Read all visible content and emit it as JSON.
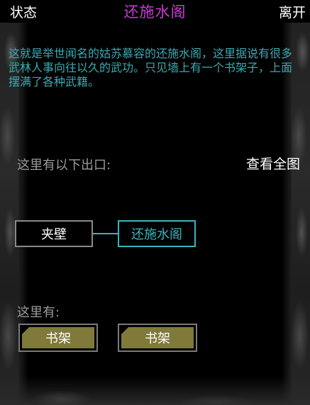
{
  "topbar": {
    "status_label": "状态",
    "room_title": "还施水阁",
    "leave_label": "离开"
  },
  "description": "这就是举世闻名的姑苏慕容的还施水阁，这里据说有很多武林人事向往以久的武功。只见墙上有一个书架子，上面摆满了各种武籍。",
  "exits": {
    "label": "这里有以下出口:",
    "map_label": "查看全图",
    "rooms": [
      {
        "name": "夹壁"
      },
      {
        "name": "还施水阁"
      }
    ]
  },
  "objects": {
    "label": "这里有:",
    "items": [
      {
        "name": "书架"
      },
      {
        "name": "书架"
      }
    ]
  },
  "colors": {
    "title": "#c93ad6",
    "description": "#3aaab2",
    "current_room": "#3ab4bc",
    "item_fill": "#7f7a3a"
  }
}
